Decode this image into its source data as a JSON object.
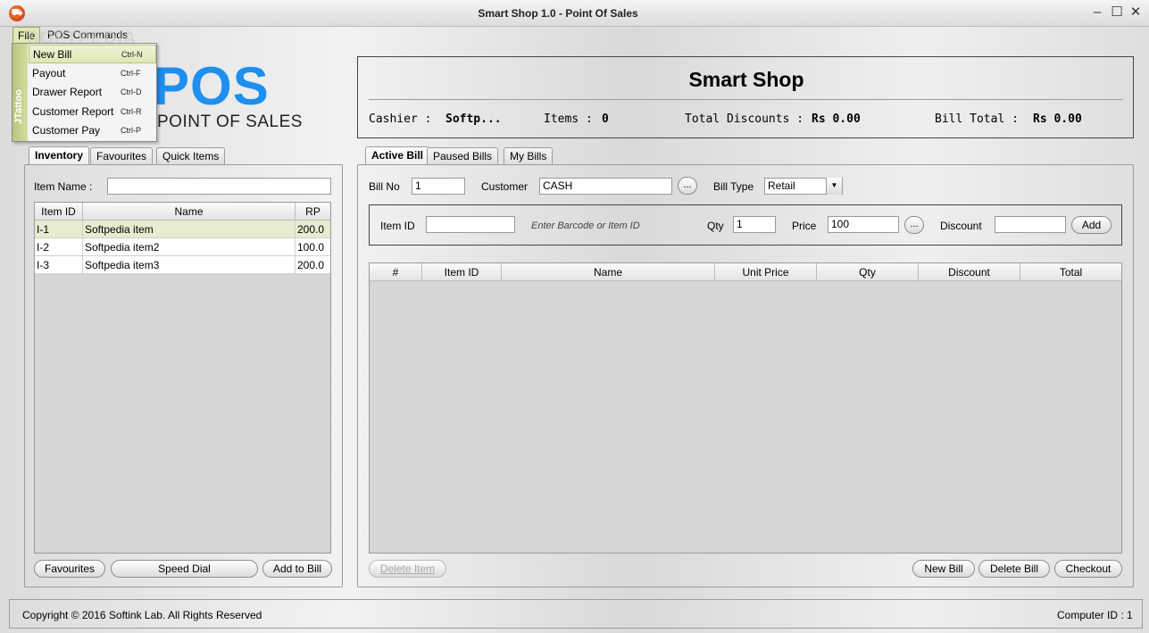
{
  "window": {
    "title": "Smart Shop 1.0 - Point Of Sales",
    "minimize": "–",
    "maximize": "☐",
    "close": "✕"
  },
  "menubar": {
    "file": "File",
    "pos_commands": "POS Commands",
    "watermark": "SOFTPEDIA"
  },
  "file_menu": {
    "strip": "JTattoo",
    "items": [
      {
        "label": "New Bill",
        "shortcut": "Ctrl-N"
      },
      {
        "label": "Payout",
        "shortcut": "Ctrl-F"
      },
      {
        "label": "Drawer Report",
        "shortcut": "Ctrl-D"
      },
      {
        "label": "Customer Report",
        "shortcut": "Ctrl-R"
      },
      {
        "label": "Customer Pay",
        "shortcut": "Ctrl-P"
      }
    ]
  },
  "logo": {
    "big": "POS",
    "sub": "POINT OF SALES"
  },
  "summary": {
    "shop_name": "Smart Shop",
    "cashier_label": "Cashier :",
    "cashier_value": "Softp...",
    "items_label": "Items :",
    "items_value": "0",
    "discounts_label": "Total Discounts :",
    "discounts_value": "Rs 0.00",
    "bill_total_label": "Bill Total :",
    "bill_total_value": "Rs 0.00"
  },
  "left_tabs": [
    "Inventory",
    "Favourites",
    "Quick Items"
  ],
  "inventory": {
    "item_name_label": "Item Name :",
    "item_name_value": "",
    "columns": [
      "Item ID",
      "Name",
      "RP"
    ],
    "rows": [
      {
        "id": "I-1",
        "name": "Softpedia item",
        "rp": "200.0"
      },
      {
        "id": "I-2",
        "name": "Softpedia item2",
        "rp": "100.0"
      },
      {
        "id": "I-3",
        "name": "Softpedia item3",
        "rp": "200.0"
      }
    ],
    "btn_favourites": "Favourites",
    "btn_speed_dial": "Speed Dial",
    "btn_add_to_bill": "Add to Bill"
  },
  "right_tabs": [
    "Active Bill",
    "Paused Bills",
    "My Bills"
  ],
  "bill": {
    "bill_no_label": "Bill No",
    "bill_no_value": "1",
    "customer_label": "Customer",
    "customer_value": "CASH",
    "bill_type_label": "Bill Type",
    "bill_type_value": "Retail",
    "ellipsis": "...",
    "item_id_label": "Item ID",
    "item_id_value": "",
    "item_id_hint": "Enter Barcode or Item ID",
    "qty_label": "Qty",
    "qty_value": "1",
    "price_label": "Price",
    "price_value": "100",
    "discount_label": "Discount",
    "discount_value": "",
    "btn_add": "Add",
    "columns": [
      "#",
      "Item ID",
      "Name",
      "Unit Price",
      "Qty",
      "Discount",
      "Total"
    ],
    "btn_delete_item": "Delete Item",
    "btn_new_bill": "New Bill",
    "btn_delete_bill": "Delete Bill",
    "btn_checkout": "Checkout"
  },
  "footer": {
    "copyright": "Copyright © 2016 Softink Lab. All Rights Reserved",
    "computer_id": "Computer ID : 1"
  }
}
